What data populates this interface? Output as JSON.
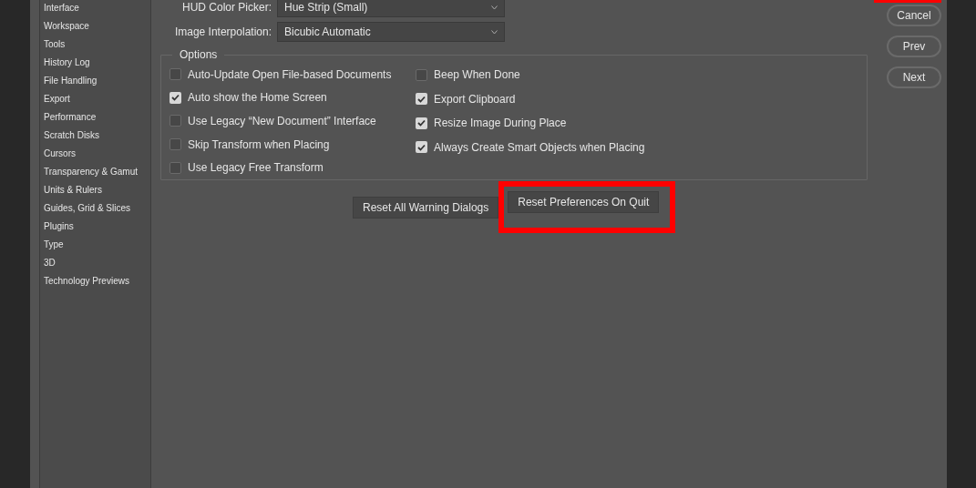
{
  "sidebar": {
    "items": [
      {
        "label": "Interface",
        "selected": false
      },
      {
        "label": "Workspace",
        "selected": false
      },
      {
        "label": "Tools",
        "selected": false
      },
      {
        "label": "History Log",
        "selected": false
      },
      {
        "label": "File Handling",
        "selected": false
      },
      {
        "label": "Export",
        "selected": false
      },
      {
        "label": "Performance",
        "selected": false
      },
      {
        "label": "Scratch Disks",
        "selected": false
      },
      {
        "label": "Cursors",
        "selected": false
      },
      {
        "label": "Transparency & Gamut",
        "selected": false
      },
      {
        "label": "Units & Rulers",
        "selected": false
      },
      {
        "label": "Guides, Grid & Slices",
        "selected": false
      },
      {
        "label": "Plugins",
        "selected": false
      },
      {
        "label": "Type",
        "selected": false
      },
      {
        "label": "3D",
        "selected": false
      },
      {
        "label": "Technology Previews",
        "selected": false
      }
    ]
  },
  "fields": [
    {
      "label": "HUD Color Picker:",
      "value": "Hue Strip (Small)"
    },
    {
      "label": "Image Interpolation:",
      "value": "Bicubic Automatic"
    }
  ],
  "options": {
    "title": "Options",
    "columns": [
      [
        {
          "label": "Auto-Update Open File-based Documents",
          "checked": false
        },
        {
          "label": "Auto show the Home Screen",
          "checked": true
        },
        {
          "label": "Use Legacy “New Document” Interface",
          "checked": false
        },
        {
          "label": "Skip Transform when Placing",
          "checked": false
        },
        {
          "label": "Use Legacy Free Transform",
          "checked": false
        }
      ],
      [
        {
          "label": "Beep When Done",
          "checked": false
        },
        {
          "label": "Export Clipboard",
          "checked": true
        },
        {
          "label": "Resize Image During Place",
          "checked": true
        },
        {
          "label": "Always Create Smart Objects when Placing",
          "checked": true
        }
      ]
    ]
  },
  "reset_buttons": [
    {
      "label": "Reset All Warning Dialogs",
      "highlighted": false
    },
    {
      "label": "Reset Preferences On Quit",
      "highlighted": true
    }
  ],
  "side_buttons": [
    {
      "label": "Cancel"
    },
    {
      "label": "Prev"
    },
    {
      "label": "Next"
    }
  ]
}
